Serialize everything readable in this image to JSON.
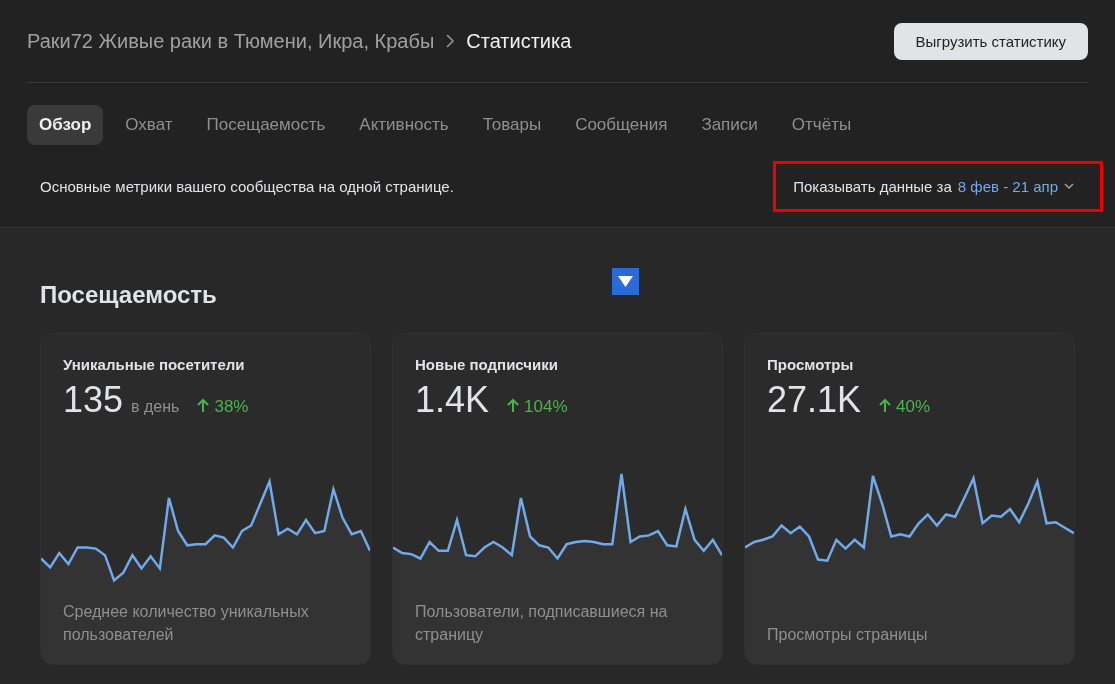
{
  "header": {
    "breadcrumb": "Раки72 Живые раки в Тюмени, Икра, Крабы",
    "title": "Статистика",
    "export_button": "Выгрузить статистику"
  },
  "tabs": [
    {
      "label": "Обзор",
      "selected": true
    },
    {
      "label": "Охват",
      "selected": false
    },
    {
      "label": "Посещаемость",
      "selected": false
    },
    {
      "label": "Активность",
      "selected": false
    },
    {
      "label": "Товары",
      "selected": false
    },
    {
      "label": "Сообщения",
      "selected": false
    },
    {
      "label": "Записи",
      "selected": false
    },
    {
      "label": "Отчёты",
      "selected": false
    }
  ],
  "description": "Основные метрики вашего сообщества на одной странице.",
  "period": {
    "label": "Показывать данные за",
    "value": "8 фев - 21 апр",
    "highlighted": true
  },
  "section": {
    "title": "Посещаемость"
  },
  "cards": [
    {
      "title": "Уникальные посетители",
      "value": "135",
      "unit": "в день",
      "change": "38%",
      "caption": "Среднее количество уникальных пользователей"
    },
    {
      "title": "Новые подписчики",
      "value": "1.4K",
      "change": "104%",
      "caption": "Пользователи, подписавшиеся на страницу"
    },
    {
      "title": "Просмотры",
      "value": "27.1K",
      "change": "40%",
      "caption": "Просмотры страницы"
    }
  ]
}
